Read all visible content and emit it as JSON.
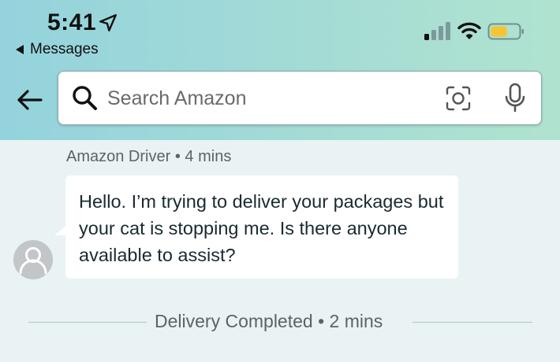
{
  "status_bar": {
    "time": "5:41",
    "back_app_label": "Messages",
    "battery_color": "#f5c531"
  },
  "search": {
    "placeholder": "Search Amazon",
    "value": ""
  },
  "message": {
    "sender": "Amazon Driver",
    "separator": "•",
    "time_ago": "4 mins",
    "text": "Hello. I’m trying to deliver your packages but your cat is stopping me. Is there anyone available to assist?"
  },
  "event": {
    "label": "Delivery Completed",
    "separator": "•",
    "time_ago": "2 mins"
  },
  "colors": {
    "header_gradient_start": "#94d3dd",
    "header_gradient_end": "#b0e3cf",
    "page_background": "#e9f3f4",
    "bubble_background": "#ffffff"
  }
}
